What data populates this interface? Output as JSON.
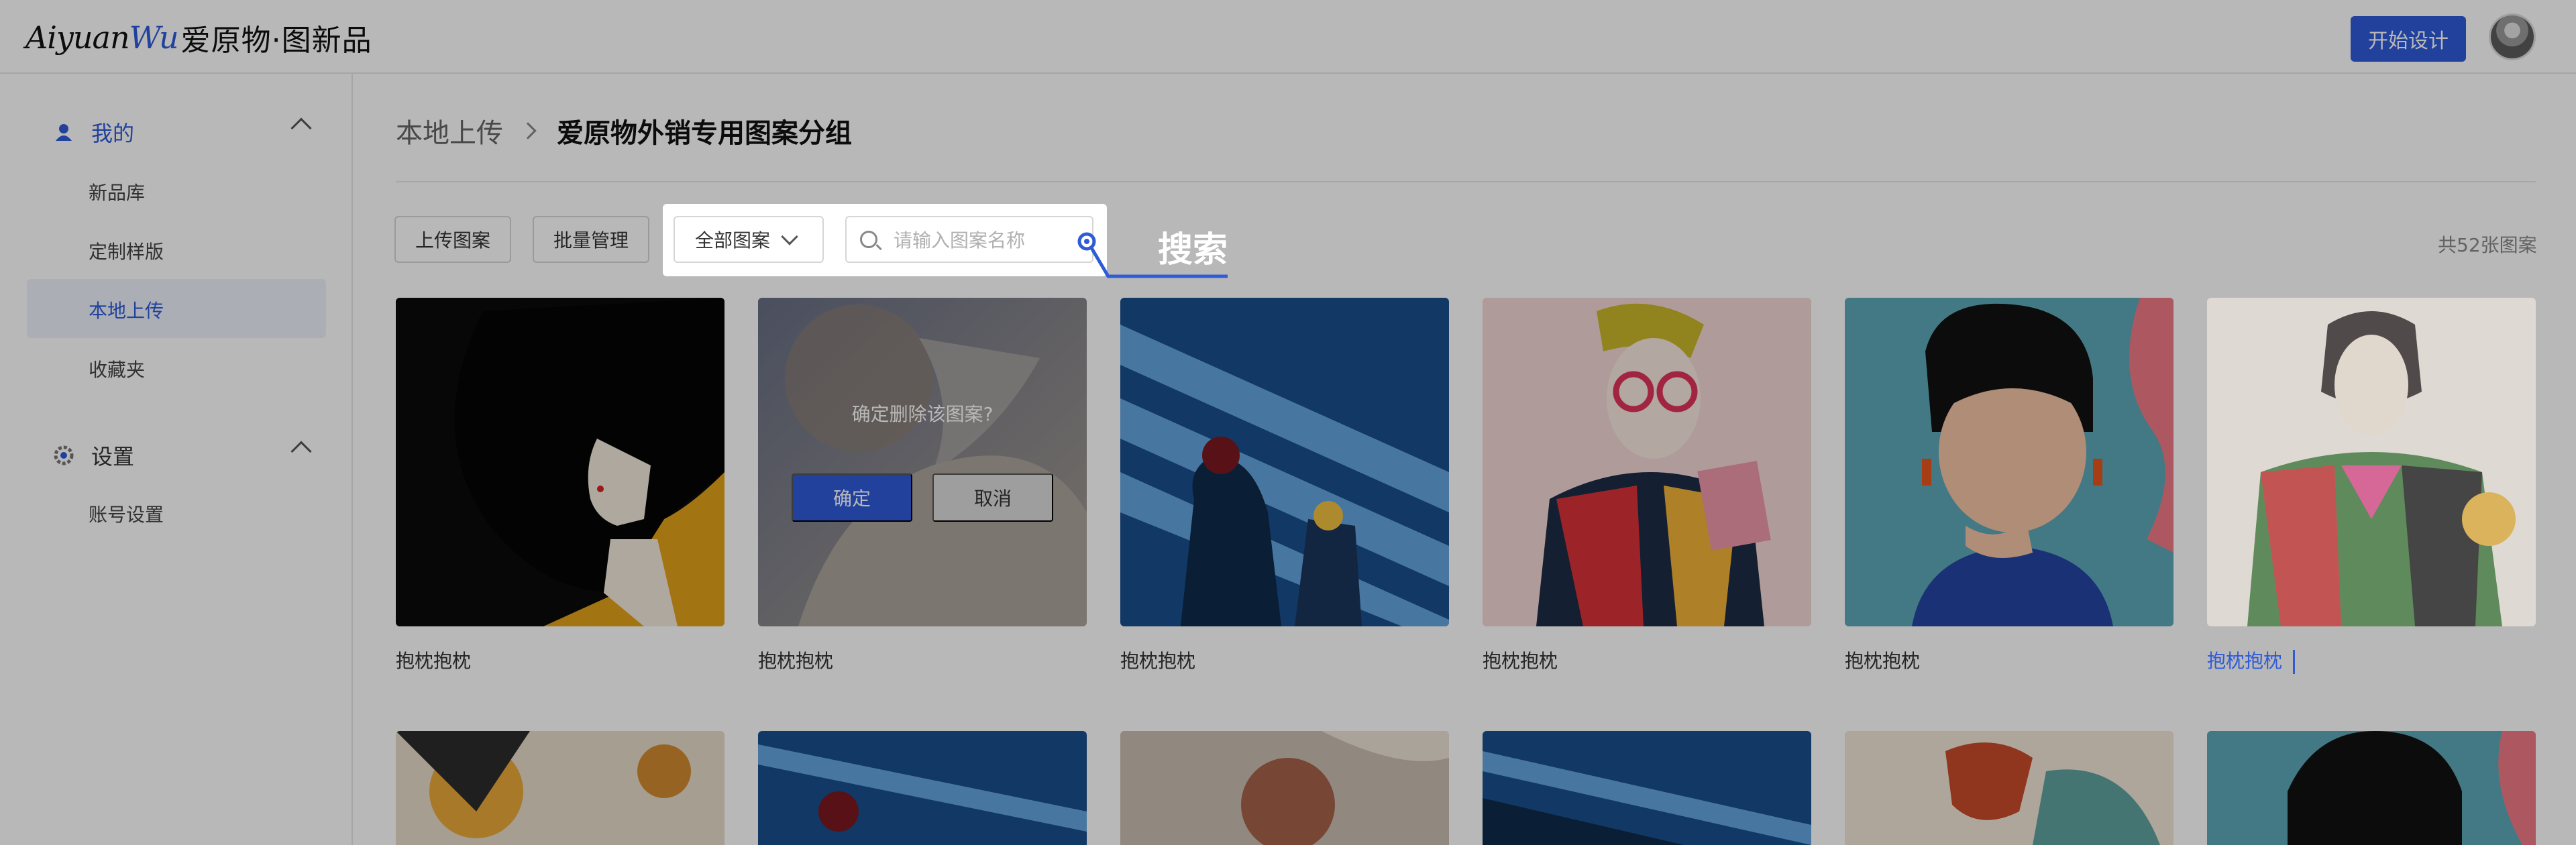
{
  "header": {
    "logo_script_a": "Aiyuan",
    "logo_script_b": "Wu",
    "logo_cn": "爱原物·图新品",
    "start_design": "开始设计"
  },
  "sidebar": {
    "groups": [
      {
        "label": "我的",
        "items": [
          "新品库",
          "定制样版",
          "本地上传",
          "收藏夹"
        ],
        "active_item": "本地上传"
      },
      {
        "label": "设置",
        "items": [
          "账号设置"
        ]
      }
    ]
  },
  "breadcrumb": {
    "parent": "本地上传",
    "current": "爱原物外销专用图案分组"
  },
  "toolbar": {
    "upload": "上传图案",
    "batch": "批量管理",
    "filter_value": "全部图案",
    "search_placeholder": "请输入图案名称",
    "total": "共52张图案"
  },
  "callout": {
    "label": "搜索"
  },
  "cards": [
    {
      "title": "抱枕抱枕"
    },
    {
      "title": "抱枕抱枕",
      "delete_prompt": "确定删除该图案?",
      "confirm": "确定",
      "cancel": "取消"
    },
    {
      "title": "抱枕抱枕"
    },
    {
      "title": "抱枕抱枕"
    },
    {
      "title": "抱枕抱枕"
    },
    {
      "title": "抱枕抱枕",
      "editing": true
    }
  ],
  "colors": {
    "accent": "#2f5bd8",
    "overlay": "rgba(0,0,0,0.28)"
  }
}
